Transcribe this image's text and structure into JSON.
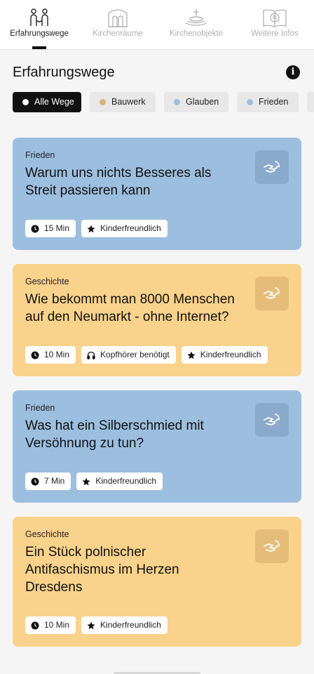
{
  "nav": {
    "tabs": [
      {
        "label": "Erfahrungswege",
        "icon": "people-path-icon",
        "active": true
      },
      {
        "label": "Kirchenräume",
        "icon": "church-building-icon",
        "active": false
      },
      {
        "label": "Kirchenobjekte",
        "icon": "altar-cross-icon",
        "active": false
      },
      {
        "label": "Weitere Infos",
        "icon": "book-info-icon",
        "active": false
      }
    ]
  },
  "header": {
    "title": "Erfahrungswege",
    "info_icon": "info-icon",
    "info_symbol": "i"
  },
  "filters": {
    "chips": [
      {
        "label": "Alle Wege",
        "dot_color": "#ffffff",
        "active": true
      },
      {
        "label": "Bauwerk",
        "dot_color": "#d9b47a",
        "active": false
      },
      {
        "label": "Glauben",
        "dot_color": "#9fbfdc",
        "active": false
      },
      {
        "label": "Frieden",
        "dot_color": "#9fbfdc",
        "active": false
      }
    ]
  },
  "colors": {
    "card_blue": "#9cbfdf",
    "card_yellow": "#f9d28b",
    "icon_tile_blue": "#89aacb",
    "icon_tile_yellow": "#e6bd78"
  },
  "cards": [
    {
      "category": "Frieden",
      "title": "Warum uns nichts Besseres als Streit passieren kann",
      "color": "blue",
      "icon": "hands-reconciliation-icon",
      "tags": [
        {
          "label": "15 Min",
          "icon": "clock-icon"
        },
        {
          "label": "Kinderfreundlich",
          "icon": "star-icon"
        }
      ]
    },
    {
      "category": "Geschichte",
      "title": "Wie bekommt man 8000 Menschen auf den Neumarkt - ohne Internet?",
      "color": "yellow",
      "icon": "hands-reconciliation-icon",
      "tags": [
        {
          "label": "10 Min",
          "icon": "clock-icon"
        },
        {
          "label": "Kopfhörer benötigt",
          "icon": "headphones-icon"
        },
        {
          "label": "Kinderfreundlich",
          "icon": "star-icon"
        }
      ]
    },
    {
      "category": "Frieden",
      "title": "Was hat ein Silberschmied mit Versöhnung zu tun?",
      "color": "blue",
      "icon": "hands-reconciliation-icon",
      "tags": [
        {
          "label": "7 Min",
          "icon": "clock-icon"
        },
        {
          "label": "Kinderfreundlich",
          "icon": "star-icon"
        }
      ]
    },
    {
      "category": "Geschichte",
      "title": "Ein Stück polnischer Antifaschismus im Herzen Dresdens",
      "color": "yellow",
      "icon": "hands-reconciliation-icon",
      "tags": [
        {
          "label": "10 Min",
          "icon": "clock-icon"
        },
        {
          "label": "Kinderfreundlich",
          "icon": "star-icon"
        }
      ]
    }
  ]
}
